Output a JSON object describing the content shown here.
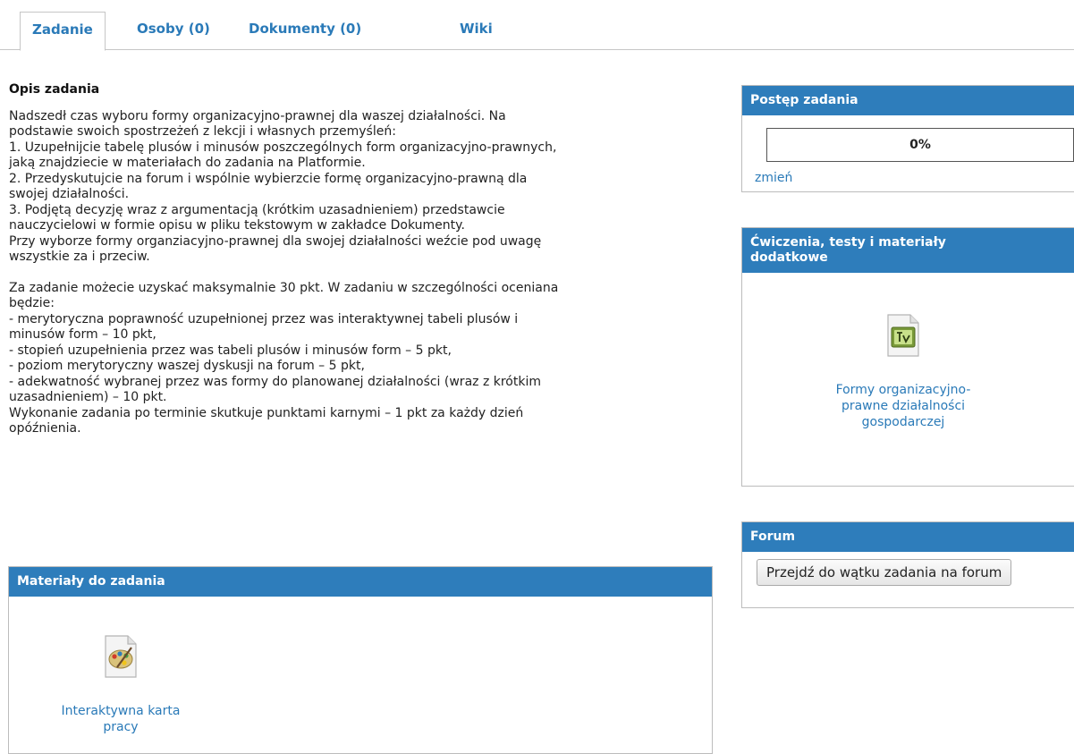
{
  "tabs": [
    {
      "label": "Zadanie"
    },
    {
      "label": "Osoby (0)"
    },
    {
      "label": "Dokumenty (0)"
    },
    {
      "label": "Wiki"
    }
  ],
  "task": {
    "heading": "Opis zadania",
    "paragraph1": "Nadszedł czas wyboru formy organizacyjno-prawnej dla waszej działalności. Na\npodstawie swoich spostrzeżeń z lekcji i własnych przemyśleń:\n1. Uzupełnijcie tabelę plusów i minusów poszczególnych form organizacyjno-prawnych,\njaką znajdziecie w materiałach do zadania na Platformie.\n2. Przedyskutujcie na forum i wspólnie wybierzcie formę organizacyjno-prawną dla\nswojej działalności.\n3. Podjętą decyzję wraz z argumentacją (krótkim uzasadnieniem) przedstawcie\nnauczycielowi w formie opisu w pliku tekstowym w zakładce Dokumenty.\nPrzy wyborze formy organziacyjno-prawnej dla swojej działalności weźcie pod uwagę\nwszystkie za i przeciw.",
    "paragraph2": "Za zadanie możecie uzyskać maksymalnie 30 pkt. W zadaniu w szczególności oceniana\nbędzie:\n- merytoryczna poprawność uzupełnionej przez was interaktywnej tabeli plusów i\nminusów form – 10 pkt,\n- stopień uzupełnienia przez was tabeli plusów i minusów form – 5 pkt,\n- poziom merytoryczny waszej dyskusji na forum – 5 pkt,\n- adekwatność wybranej przez was formy do planowanej działalności (wraz z krótkim\nuzasadnieniem) – 10 pkt.\nWykonanie zadania po terminie skutkuje punktami karnymi – 1 pkt za każdy dzień\nopóźnienia."
  },
  "materials": {
    "title": "Materiały do zadania",
    "item_label": "Interaktywna karta\npracy",
    "item_icon": "palette-file-icon"
  },
  "progress": {
    "title": "Postęp zadania",
    "value_text": "0%",
    "value": 0,
    "change_link": "zmień"
  },
  "extras": {
    "title": "Ćwiczenia, testy i materiały\ndodatkowe",
    "item_label": "Formy organizacyjno-\nprawne działalności\ngospodarczej",
    "item_icon": "flash-video-file-icon"
  },
  "forum": {
    "title": "Forum",
    "button_label": "Przejdź do wątku zadania na forum"
  },
  "colors": {
    "accent": "#2e7dbb",
    "link": "#2a7ab8",
    "progress_fill": "#8fc04a"
  }
}
